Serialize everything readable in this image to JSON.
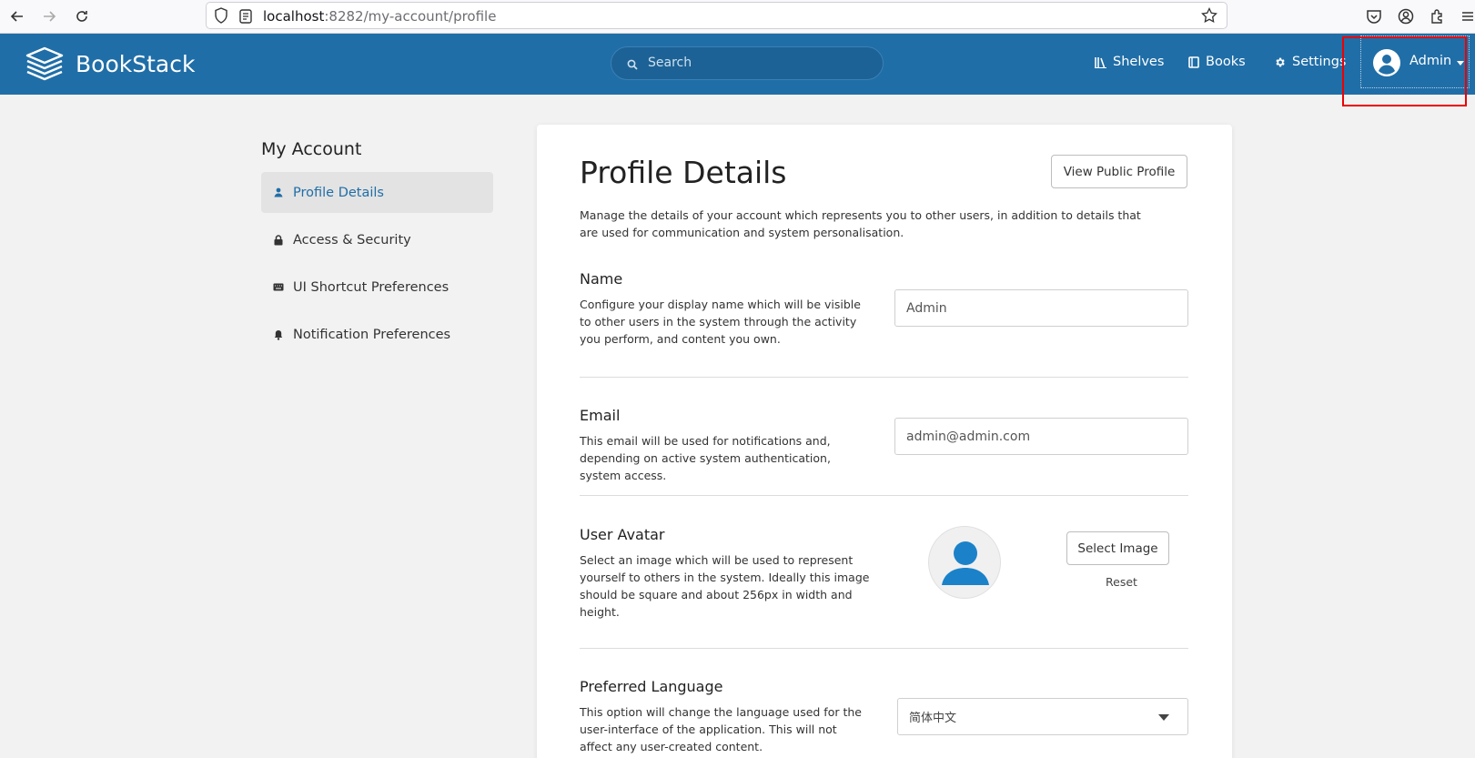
{
  "browser": {
    "url_host": "localhost",
    "url_rest": ":8282/my-account/profile"
  },
  "header": {
    "app_name": "BookStack",
    "search_placeholder": "Search",
    "nav": {
      "shelves": "Shelves",
      "books": "Books",
      "settings": "Settings"
    },
    "user_name": "Admin",
    "brand_color": "#206ea7"
  },
  "sidebar": {
    "title": "My Account",
    "items": [
      {
        "label": "Profile Details",
        "icon": "user-icon",
        "active": true
      },
      {
        "label": "Access & Security",
        "icon": "lock-icon",
        "active": false
      },
      {
        "label": "UI Shortcut Preferences",
        "icon": "keyboard-icon",
        "active": false
      },
      {
        "label": "Notification Preferences",
        "icon": "bell-icon",
        "active": false
      }
    ]
  },
  "main": {
    "title": "Profile Details",
    "view_public_profile": "View Public Profile",
    "intro": "Manage the details of your account which represents you to other users, in addition to details that are used for communication and system personalisation.",
    "name": {
      "label": "Name",
      "description": "Configure your display name which will be visible to other users in the system through the activity you perform, and content you own.",
      "value": "Admin"
    },
    "email": {
      "label": "Email",
      "description": "This email will be used for notifications and, depending on active system authentication, system access.",
      "value": "admin@admin.com"
    },
    "avatar": {
      "label": "User Avatar",
      "description": "Select an image which will be used to represent yourself to others in the system. Ideally this image should be square and about 256px in width and height.",
      "select_button": "Select Image",
      "reset": "Reset"
    },
    "language": {
      "label": "Preferred Language",
      "description": "This option will change the language used for the user-interface of the application. This will not affect any user-created content.",
      "value": "简体中文"
    }
  }
}
